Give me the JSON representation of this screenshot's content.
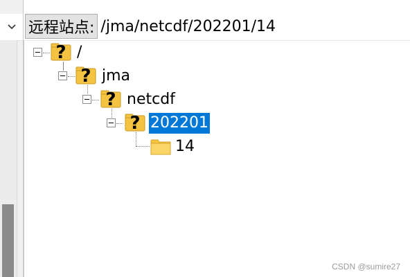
{
  "address_bar": {
    "label": "远程站点:",
    "path": "/jma/netcdf/202201/14"
  },
  "tree": {
    "nodes": [
      {
        "label": "/",
        "icon": "unknown-folder-icon",
        "expanded": true
      },
      {
        "label": "jma",
        "icon": "unknown-folder-icon",
        "expanded": true
      },
      {
        "label": "netcdf",
        "icon": "unknown-folder-icon",
        "expanded": true
      },
      {
        "label": "202201",
        "icon": "unknown-folder-icon",
        "expanded": true,
        "selected": true
      },
      {
        "label": "14",
        "icon": "folder-icon"
      }
    ]
  },
  "watermark": "CSDN @sumire27",
  "colors": {
    "selection": "#0078d7",
    "folder": "#f5c342",
    "scroll_thumb": "#8a8a8a"
  }
}
